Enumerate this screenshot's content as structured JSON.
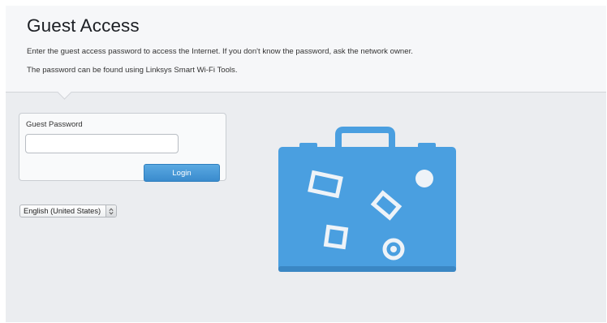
{
  "header": {
    "title": "Guest Access",
    "description_line1": "Enter the guest access password to access the Internet. If you don't know the password, ask the network owner.",
    "description_line2": "The password can be found using Linksys Smart Wi-Fi Tools."
  },
  "login_form": {
    "password_label": "Guest Password",
    "password_value": "",
    "login_button_label": "Login"
  },
  "language_selector": {
    "selected": "English (United States)",
    "icon": "chevron-up-down-icon"
  },
  "illustration": {
    "icon": "suitcase-icon",
    "colors": {
      "body": "#4a9fe0",
      "body_dark": "#3a87c4",
      "stickers": "#eef3f8"
    }
  }
}
